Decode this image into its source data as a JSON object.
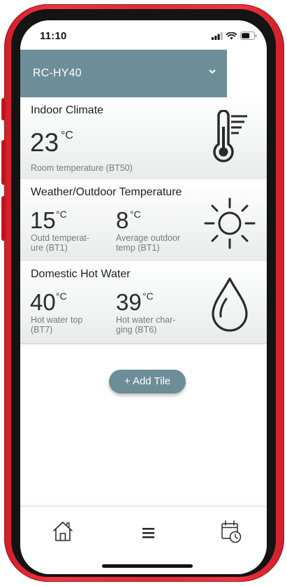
{
  "status_bar": {
    "time": "11:10"
  },
  "header": {
    "device_name": "RC-HY40"
  },
  "tiles": {
    "indoor": {
      "title": "Indoor Climate",
      "value": "23",
      "unit": "°C",
      "label": "Room temperature (BT50)",
      "icon": "thermometer-icon"
    },
    "outdoor": {
      "title": "Weather/Outdoor Temperature",
      "value1": "15",
      "unit1": "°C",
      "label1_line1": "Outd temperat-",
      "label1_line2": "ure  (BT1)",
      "value2": "8",
      "unit2": "°C",
      "label2_line1": "Average outdoor",
      "label2_line2": "temp (BT1)",
      "icon": "sun-icon"
    },
    "hot_water": {
      "title": "Domestic Hot Water",
      "value1": "40",
      "unit1": "°C",
      "label1_line1": "Hot water top",
      "label1_line2": "(BT7)",
      "value2": "39",
      "unit2": "°C",
      "label2_line1": "Hot water char-",
      "label2_line2": "ging (BT6)",
      "icon": "water-drop-icon"
    }
  },
  "actions": {
    "add_tile": "+ Add Tile"
  },
  "nav": {
    "items": [
      "home-icon",
      "menu-icon",
      "calendar-clock-icon"
    ]
  },
  "colors": {
    "accent": "#6d8e98",
    "frame": "#e12a33"
  }
}
